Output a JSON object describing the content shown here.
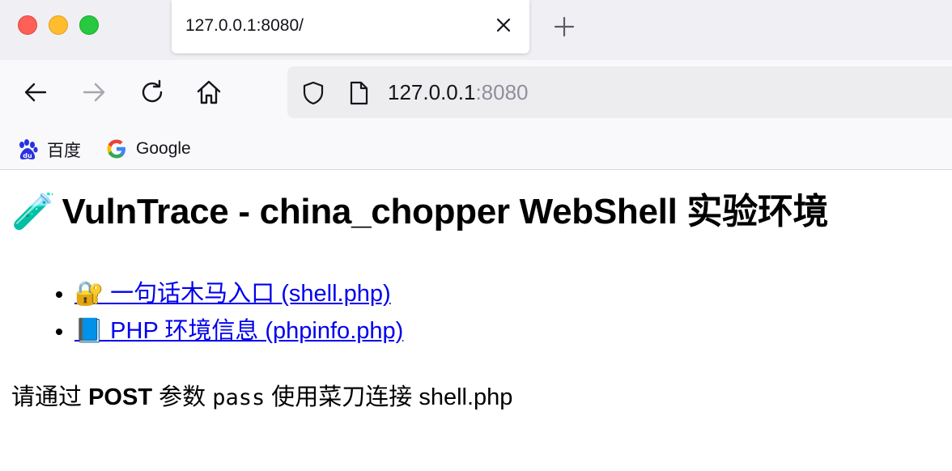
{
  "window": {
    "tab_title": "127.0.0.1:8080/"
  },
  "navbar": {
    "url_host": "127.0.0.1",
    "url_port": ":8080"
  },
  "bookmarks": [
    {
      "label": "百度",
      "icon": "baidu-icon"
    },
    {
      "label": "Google",
      "icon": "google-icon"
    }
  ],
  "page": {
    "title_emoji": "🧪",
    "title": "VulnTrace - china_chopper WebShell 实验环境",
    "links": [
      {
        "emoji": "🔐",
        "label": "一句话木马入口 (shell.php)"
      },
      {
        "emoji": "📘",
        "label": "PHP 环境信息 (phpinfo.php)"
      }
    ],
    "note": {
      "prefix": "请通过",
      "method": "POST",
      "middle": "参数",
      "param": "pass",
      "suffix": "使用菜刀连接 shell.php"
    }
  },
  "colors": {
    "link": "#0000ee",
    "titlebar_bg": "#f0f0f4",
    "toolbar_bg": "#f9f9fb",
    "urlbar_bg": "#ededf0"
  }
}
